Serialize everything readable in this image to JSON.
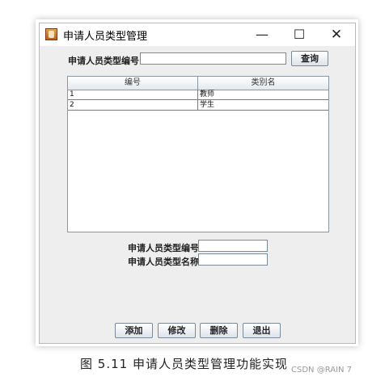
{
  "window": {
    "title": "申请人员类型管理",
    "min_glyph": "—",
    "max_glyph": "☐",
    "close_glyph": "✕"
  },
  "search": {
    "label": "申请人员类型编号",
    "value": "",
    "button_label": "查询"
  },
  "table": {
    "columns": [
      "编号",
      "类别名"
    ],
    "rows": [
      [
        "1",
        "教师"
      ],
      [
        "2",
        "学生"
      ]
    ]
  },
  "form": {
    "id_label": "申请人员类型编号:",
    "id_value": "",
    "name_label": "申请人员类型名称:",
    "name_value": ""
  },
  "actions": {
    "add": "添加",
    "edit": "修改",
    "delete": "删除",
    "exit": "退出"
  },
  "caption": "图 5.11 申请人员类型管理功能实现",
  "watermark": "CSDN @RAIN 7"
}
